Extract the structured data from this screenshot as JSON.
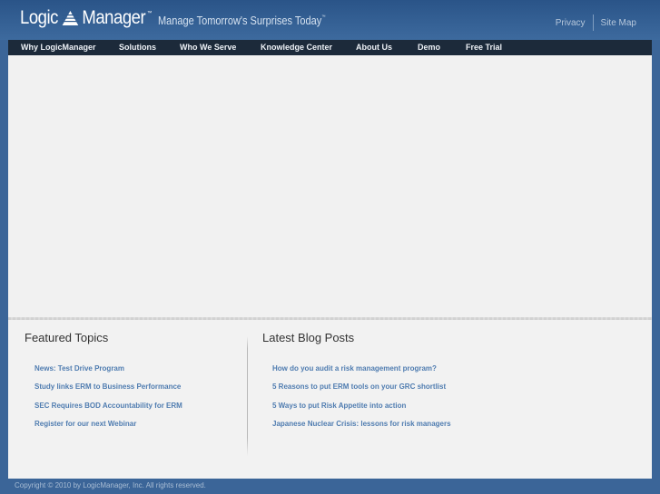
{
  "header": {
    "logo_left": "Logic",
    "logo_right": "Manager",
    "logo_tm": "™",
    "tagline": "Manage Tomorrow's Surprises Today",
    "tagline_tm": "™",
    "util_links": [
      {
        "label": "Privacy"
      },
      {
        "label": "Site Map"
      }
    ]
  },
  "nav": {
    "items": [
      {
        "label": "Why LogicManager"
      },
      {
        "label": "Solutions"
      },
      {
        "label": "Who We Serve"
      },
      {
        "label": "Knowledge Center"
      },
      {
        "label": "About Us"
      },
      {
        "label": "Demo"
      },
      {
        "label": "Free Trial"
      }
    ]
  },
  "featured": {
    "title": "Featured Topics",
    "items": [
      {
        "label": "News: Test Drive Program"
      },
      {
        "label": "Study links ERM to Business Performance"
      },
      {
        "label": "SEC Requires BOD Accountability for ERM"
      },
      {
        "label": "Register for our next Webinar"
      }
    ]
  },
  "blog": {
    "title": "Latest Blog Posts",
    "items": [
      {
        "label": "How do you audit a risk management program?"
      },
      {
        "label": "5 Reasons to put ERM tools on your GRC shortlist"
      },
      {
        "label": "5 Ways to put Risk Appetite into action"
      },
      {
        "label": "Japanese Nuclear Crisis: lessons for risk managers"
      }
    ]
  },
  "footer": {
    "copyright": "Copyright © 2010 by LogicManager, Inc. All rights reserved."
  },
  "colors": {
    "brand_blue": "#3b6598",
    "nav_bg": "#1c2a3a",
    "link": "#4f7cb0"
  }
}
